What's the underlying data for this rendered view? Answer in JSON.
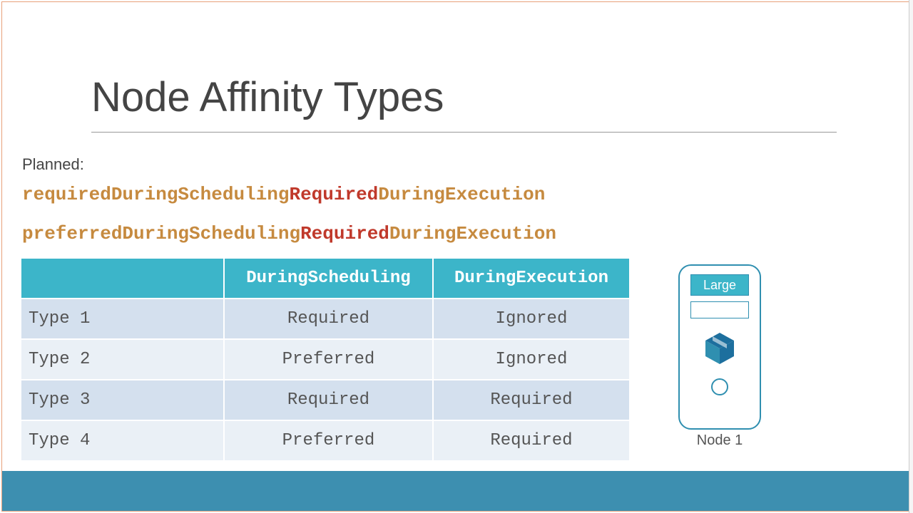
{
  "title": "Node Affinity Types",
  "planned_label": "Planned:",
  "code_lines": [
    {
      "pre": "requiredDuringScheduling",
      "hl": "Required",
      "post": "DuringExecution"
    },
    {
      "pre": "preferredDuringScheduling",
      "hl": "Required",
      "post": "DuringExecution"
    }
  ],
  "table": {
    "headers": [
      "",
      "DuringScheduling",
      "DuringExecution"
    ],
    "rows": [
      {
        "label": "Type 1",
        "scheduling": "Required",
        "execution": "Ignored"
      },
      {
        "label": "Type 2",
        "scheduling": "Preferred",
        "execution": "Ignored"
      },
      {
        "label": "Type 3",
        "scheduling": "Required",
        "execution": "Required"
      },
      {
        "label": "Type 4",
        "scheduling": "Preferred",
        "execution": "Required"
      }
    ]
  },
  "node": {
    "badge": "Large",
    "label": "Node 1"
  }
}
